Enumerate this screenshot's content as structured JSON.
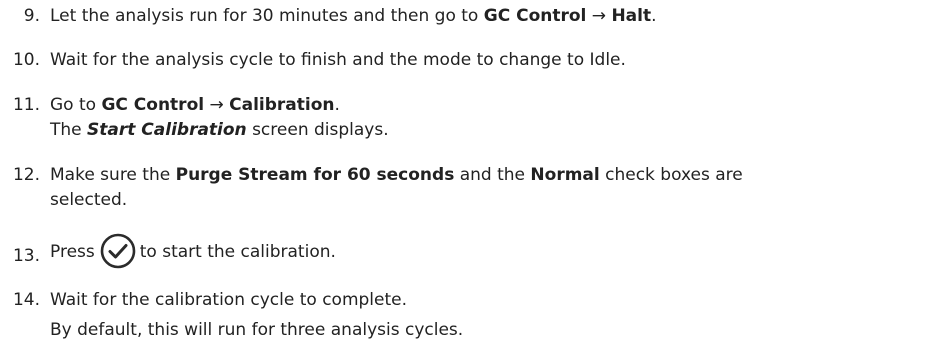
{
  "steps": [
    {
      "number": "9.",
      "pre": "Let the analysis run for 30 minutes and then go to ",
      "bold1": "GC Control",
      "arrow": " → ",
      "bold2": "Halt",
      "post": "."
    },
    {
      "number": "10.",
      "text": "Wait for the analysis cycle to finish and the mode to change to Idle."
    },
    {
      "number": "11.",
      "pre": "Go to ",
      "bold1": "GC Control",
      "arrow": " → ",
      "bold2": "Calibration",
      "post": ".",
      "sub_pre": "The ",
      "sub_bi": "Start Calibration",
      "sub_post": " screen displays."
    },
    {
      "number": "12.",
      "pre": "Make sure the ",
      "bold1": "Purge Stream for 60 seconds",
      "mid": " and the ",
      "bold2": "Normal",
      "post": " check boxes are",
      "line2": "selected."
    },
    {
      "number": "13.",
      "pre": "Press",
      "icon": "checkmark-circle-icon",
      "post": "to start the calibration."
    },
    {
      "number": "14.",
      "text": "Wait for the calibration cycle to complete.",
      "line2": "By default, this will run for three analysis cycles."
    }
  ]
}
